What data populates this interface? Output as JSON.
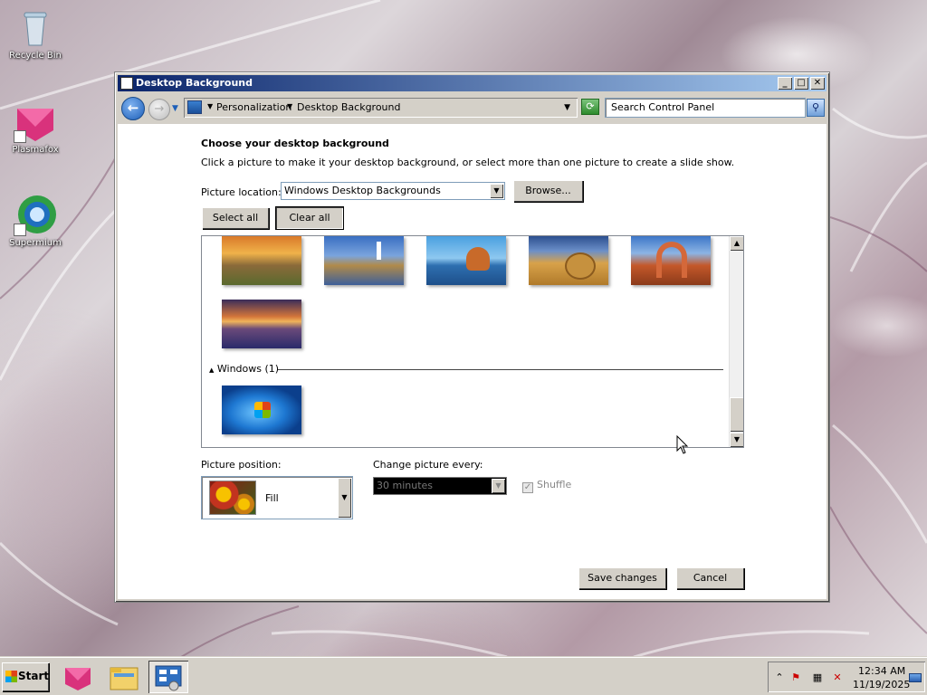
{
  "desktop": {
    "icons": [
      {
        "label": "Recycle Bin",
        "icon": "recycle-bin-icon"
      },
      {
        "label": "Plasmafox",
        "icon": "plasmafox-icon"
      },
      {
        "label": "Supermium",
        "icon": "supermium-icon"
      }
    ]
  },
  "window": {
    "title": "Desktop Background",
    "controls": {
      "minimize": "_",
      "maximize": "□",
      "close": "✕"
    },
    "nav": {
      "back": "←",
      "forward": "→",
      "breadcrumbs": [
        "Personalization",
        "Desktop Background"
      ],
      "search_placeholder": "Search Control Panel"
    },
    "heading": "Choose your desktop background",
    "subheading": "Click a picture to make it your desktop background, or select more than one picture to create a slide show.",
    "picture_location_label": "Picture location:",
    "picture_location_value": "Windows Desktop Backgrounds",
    "browse_label": "Browse...",
    "select_all_label": "Select all",
    "clear_all_label": "Clear all",
    "gallery": {
      "section_windows": "Windows (1)"
    },
    "picture_position_label": "Picture position:",
    "picture_position_value": "Fill",
    "change_every_label": "Change picture every:",
    "change_every_value": "30 minutes",
    "shuffle_label": "Shuffle",
    "shuffle_checked": true,
    "save_label": "Save changes",
    "cancel_label": "Cancel"
  },
  "taskbar": {
    "start_label": "Start",
    "clock_time": "12:34 AM",
    "clock_date": "11/19/2025"
  }
}
